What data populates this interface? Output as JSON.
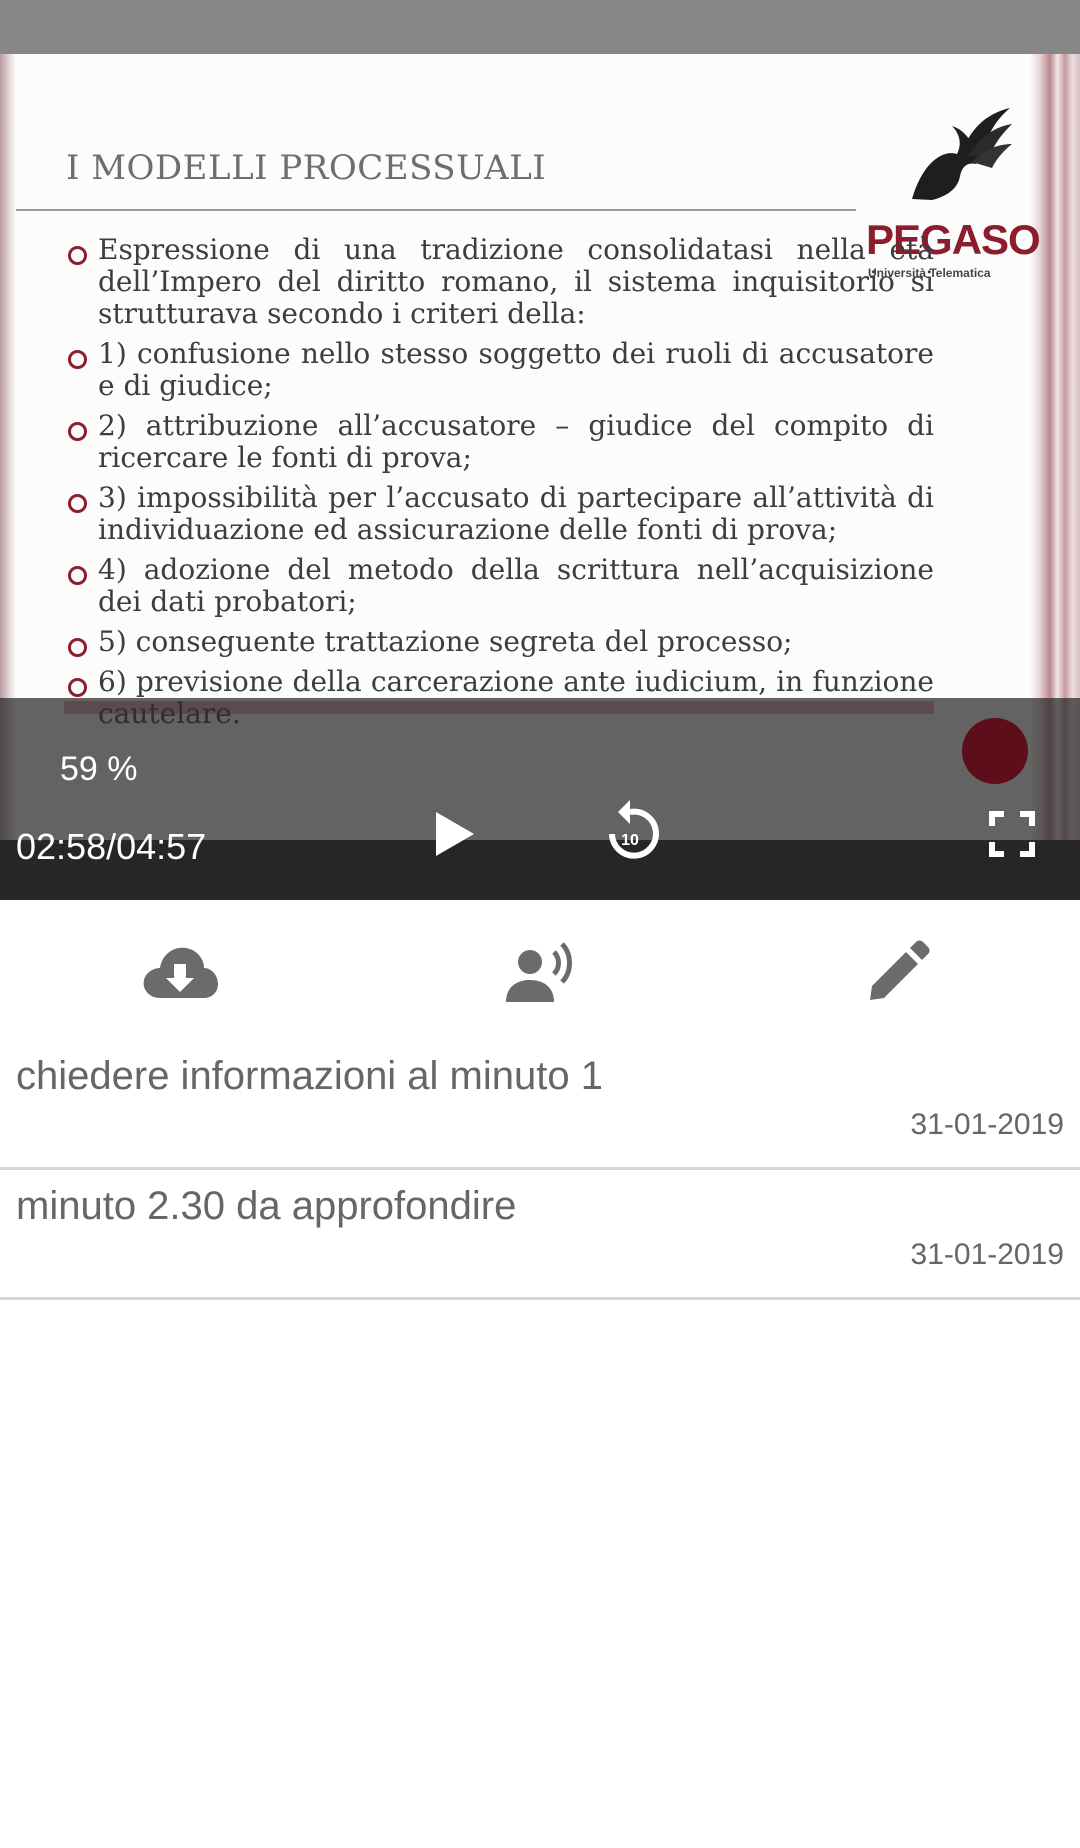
{
  "slide": {
    "title": "I MODELLI PROCESSUALI",
    "logo_text": "PEGASO",
    "logo_subtitle": "Università Telematica",
    "bullets": [
      "Espressione di una tradizione consolidatasi nella età dell’Impero del diritto romano, il sistema inquisitorio si strutturava secondo i criteri della:",
      "1) confusione nello stesso soggetto dei ruoli di accusatore e di giudice;",
      "2) attribuzione all’accusatore – giudice del compito di ricercare le fonti di prova;",
      "3) impossibilità per l’accusato di partecipare all’attività di individuazione ed assicurazione delle fonti di prova;",
      "4) adozione del metodo della scrittura nell’acquisizione dei dati probatori;",
      "5) conseguente trattazione segreta del processo;",
      "6) previsione della carcerazione ante iudicium, in funzione cautelare."
    ]
  },
  "player": {
    "progress_label": "59 %",
    "time_label": "02:58/04:57",
    "replay_seconds": "10"
  },
  "actions": {
    "download_icon": "cloud-download-icon",
    "voice_icon": "record-voice-icon",
    "edit_icon": "pencil-icon"
  },
  "notes": [
    {
      "text": "chiedere informazioni al minuto 1",
      "date": "31-01-2019"
    },
    {
      "text": "minuto 2.30 da approfondire",
      "date": "31-01-2019"
    }
  ],
  "colors": {
    "accent": "#8b1d2c",
    "icon_gray": "#6b6b6b",
    "divider": "#d8d8d8"
  }
}
